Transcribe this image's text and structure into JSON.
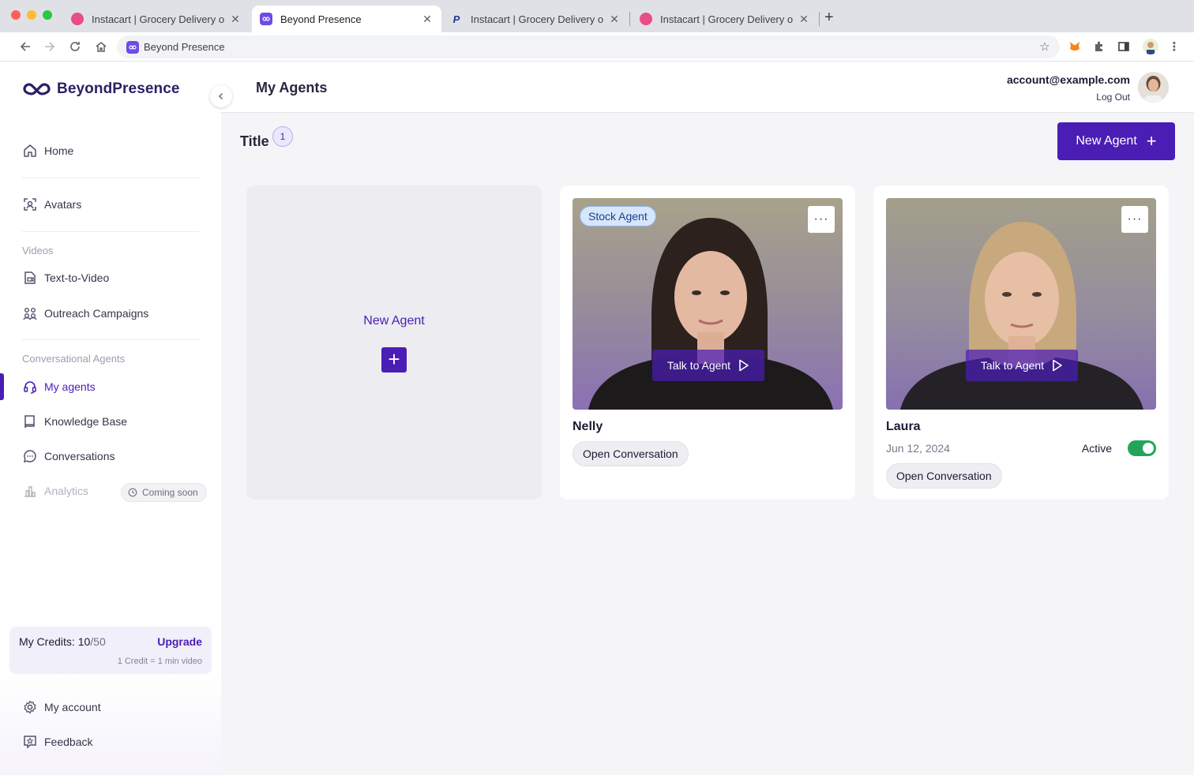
{
  "browser": {
    "tabs": [
      {
        "title": "Instacart | Grocery Delivery or",
        "icon": "dribbble-icon"
      },
      {
        "title": "Beyond Presence",
        "icon": "beyond-presence-favicon"
      },
      {
        "title": "Instacart | Grocery Delivery or",
        "icon": "paypal-icon"
      },
      {
        "title": "Instacart | Grocery Delivery or",
        "icon": "dribbble-icon"
      }
    ],
    "address": "Beyond Presence"
  },
  "sidebar": {
    "brand": "BeyondPresence",
    "items": {
      "home": "Home",
      "avatars": "Avatars",
      "videos_label": "Videos",
      "text_to_video": "Text-to-Video",
      "outreach": "Outreach Campaigns",
      "agents_label": "Conversational Agents",
      "my_agents": "My agents",
      "knowledge_base": "Knowledge Base",
      "conversations": "Conversations",
      "analytics": "Analytics",
      "coming_soon": "Coming soon"
    },
    "credits": {
      "label": "My Credits: ",
      "used": "10",
      "total": "/50",
      "upgrade": "Upgrade",
      "note": "1 Credit = 1 min video"
    },
    "footer": {
      "my_account": "My account",
      "feedback": "Feedback"
    }
  },
  "header": {
    "title": "My Agents",
    "email": "account@example.com",
    "logout": "Log Out"
  },
  "main": {
    "section_title": "Title",
    "count": "1",
    "new_agent_button": "New Agent",
    "new_agent_card": "New Agent",
    "agents": [
      {
        "name": "Nelly",
        "tag": "Stock Agent",
        "talk": "Talk to Agent",
        "open": "Open Conversation",
        "more": "···"
      },
      {
        "name": "Laura",
        "date": "Jun 12, 2024",
        "status": "Active",
        "active": true,
        "talk": "Talk to Agent",
        "open": "Open Conversation",
        "more": "···"
      }
    ]
  },
  "colors": {
    "accent": "#4a1db5",
    "toggle_on": "#22a55b",
    "stock_tag_bg": "#d6e6fb"
  }
}
